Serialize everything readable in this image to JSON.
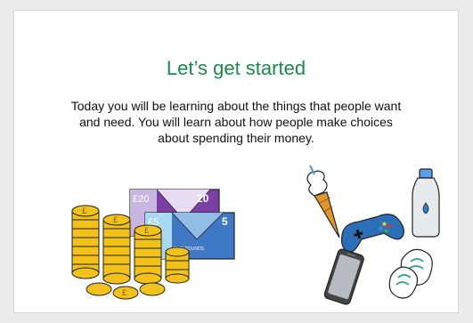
{
  "slide": {
    "title": "Let’s get started",
    "body": "Today you will be learning about the things that people want and need. You will learn about how people make choices about spending their money."
  },
  "illustrations": {
    "money": {
      "note_20": {
        "symbol": "£20",
        "value": "20"
      },
      "note_5": {
        "symbol": "£5",
        "value": "5",
        "words": "FIVE POUNDS"
      },
      "coin_symbol": "£"
    },
    "items": [
      "ice-cream",
      "game-controller",
      "water-bottle",
      "mobile-phone",
      "trainers"
    ]
  },
  "colors": {
    "title": "#1d8a4a",
    "coin": "#f2c21b",
    "note_20": "#7b3fa6",
    "note_5": "#3f78c4"
  }
}
